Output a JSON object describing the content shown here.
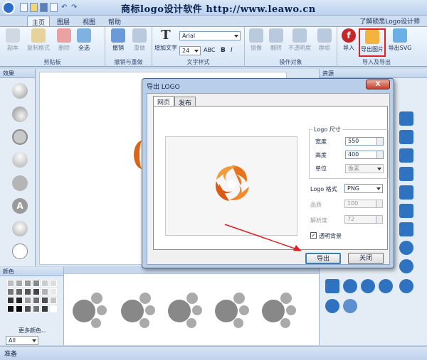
{
  "app": {
    "title": "商标logo设计软件  http://www.leawo.cn",
    "learn_link": "了解硕思Logo设计师"
  },
  "ribbon_tabs": [
    "主页",
    "图层",
    "视图",
    "帮助"
  ],
  "ribbon": {
    "clipboard": {
      "label": "剪贴板",
      "buttons": [
        "副本",
        "复制格式",
        "删除",
        "全选"
      ]
    },
    "undo": {
      "label": "撤销与重做",
      "buttons": [
        "撤销",
        "重做"
      ]
    },
    "text": {
      "label": "文字样式",
      "add_text": "增加文字",
      "font": "Arial",
      "size": "24",
      "style_buttons": [
        "ABC",
        "B",
        "I"
      ]
    },
    "ops": {
      "label": "操作对象",
      "buttons": [
        "镜像",
        "翻转",
        "不透明度",
        "群组"
      ]
    },
    "export": {
      "label": "导入及导出",
      "buttons": [
        "导入",
        "导出图片",
        "导出SVG"
      ]
    }
  },
  "panels": {
    "effects": "效果",
    "colors": "颜色",
    "more_colors": "更多颜色...",
    "filter": "All",
    "shapes": "资源"
  },
  "status": "准备",
  "dialog": {
    "title": "导出 LOGO",
    "close": "X",
    "tabs": [
      "网页",
      "发布"
    ],
    "size_group": "Logo 尺寸",
    "width_label": "宽度",
    "width": "550",
    "height_label": "高度",
    "height": "400",
    "unit_label": "单位",
    "unit": "像素",
    "format_label": "Logo 格式",
    "format": "PNG",
    "quality_label": "品质",
    "quality": "100",
    "dpi_label": "解析度",
    "dpi": "72",
    "transparent_label": "透明背景",
    "transparent": true,
    "export_button": "导出",
    "close_button": "关闭"
  },
  "colors": {
    "accent": "#2d6fc8",
    "highlight_box": "#e02020",
    "arrow": "#e02020",
    "logo_orange": "#e8731a"
  }
}
